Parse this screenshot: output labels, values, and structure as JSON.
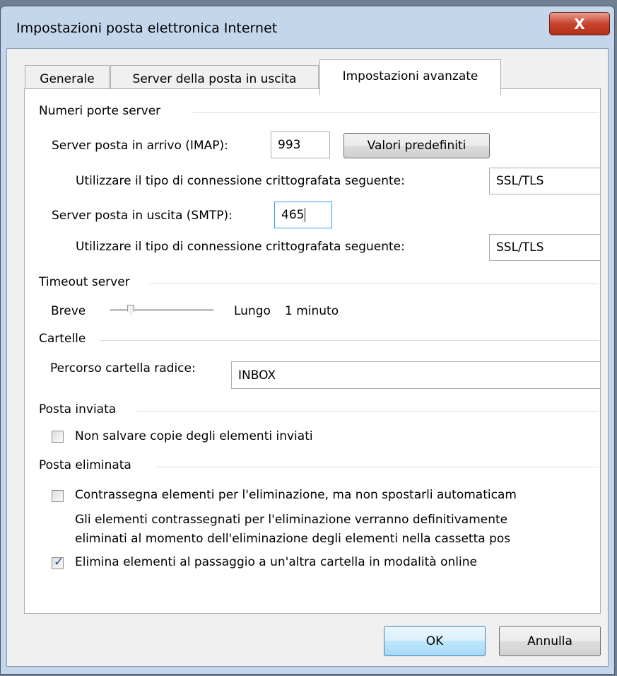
{
  "window": {
    "title": "Impostazioni posta elettronica Internet",
    "close_label": "X"
  },
  "tabs": [
    {
      "label": "Generale"
    },
    {
      "label": "Server della posta in uscita"
    },
    {
      "label": "Impostazioni avanzate"
    }
  ],
  "ports": {
    "group_title": "Numeri porte server",
    "incoming_label": "Server posta in arrivo (IMAP):",
    "incoming_value": "993",
    "defaults_button": "Valori predefiniti",
    "encryption_label_1": "Utilizzare il tipo di connessione crittografata seguente:",
    "encryption_value_1": "SSL/TLS",
    "outgoing_label": "Server posta in uscita (SMTP):",
    "outgoing_value": "465",
    "encryption_label_2": "Utilizzare il tipo di connessione crittografata seguente:",
    "encryption_value_2": "SSL/TLS"
  },
  "timeout": {
    "group_title": "Timeout server",
    "short_label": "Breve",
    "long_label": "Lungo",
    "value_text": "1 minuto",
    "slider_level": 0.2
  },
  "folders": {
    "group_title": "Cartelle",
    "root_label": "Percorso cartella radice:",
    "root_value": "INBOX"
  },
  "sent": {
    "group_title": "Posta inviata",
    "no_copies_label": "Non salvare copie degli elementi inviati",
    "no_copies_checked": false
  },
  "deleted": {
    "group_title": "Posta eliminata",
    "mark_label": "Contrassegna elementi per l'eliminazione, ma non spostarli automaticam",
    "mark_checked": false,
    "note_line1": "Gli elementi contrassegnati per l'eliminazione verranno definitivamente",
    "note_line2": "eliminati al momento dell'eliminazione degli elementi nella cassetta pos",
    "purge_label": "Elimina elementi al passaggio a un'altra cartella in modalità online",
    "purge_checked": true,
    "check_glyph": "✓"
  },
  "footer": {
    "ok_label": "OK",
    "cancel_label": "Annulla"
  }
}
